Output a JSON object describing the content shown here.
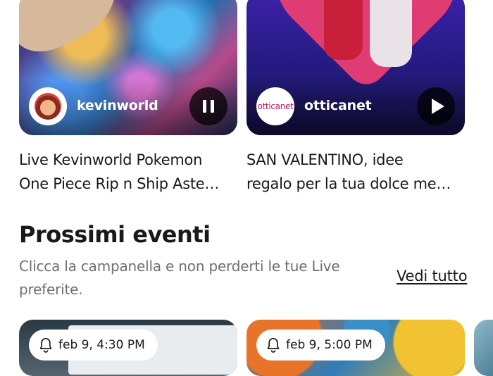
{
  "live_cards": [
    {
      "channel": "kevinworld",
      "control": "pause-icon",
      "title_line1": "Live Kevinworld Pokemon",
      "title_line2": "One Piece Rip n Ship Aste…"
    },
    {
      "channel": "otticanet",
      "logo_text": "otticanet",
      "control": "play-icon",
      "title_line1": "SAN VALENTINO, idee",
      "title_line2": "regalo per la tua dolce me…"
    }
  ],
  "upcoming": {
    "title": "Prossimi eventi",
    "subtitle": "Clicca la campanella e non perderti le tue Live preferite.",
    "see_all": "Vedi tutto",
    "events": [
      {
        "time": "feb 9, 4:30 PM",
        "icon": "bell-icon"
      },
      {
        "time": "feb 9, 5:00 PM",
        "icon": "bell-icon"
      }
    ]
  },
  "colors": {
    "text": "#191919",
    "muted": "#707070",
    "overlay": "#000000",
    "accent_pink": "#e03c74"
  }
}
